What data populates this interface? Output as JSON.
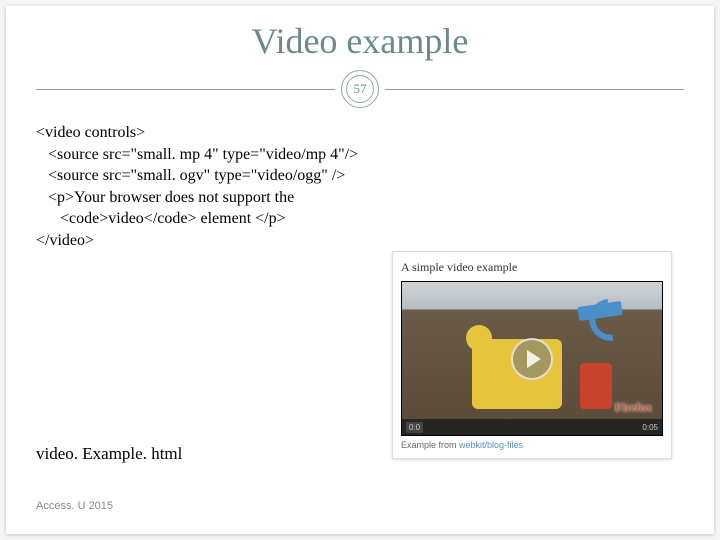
{
  "slide": {
    "title": "Video example",
    "number": "57",
    "code_lines": [
      "<video controls>",
      "   <source src=\"small. mp 4\" type=\"video/mp 4\"/>",
      "   <source src=\"small. ogv\" type=\"video/ogg\" />",
      "   <p>Your browser does not support the",
      "      <code>video</code> element </p>",
      "</video>"
    ],
    "filename": "video. Example. html",
    "conference": "Access. U 2015"
  },
  "video_card": {
    "heading": "A simple video example",
    "time_start": "0:0",
    "time_end": "0:05",
    "watermark": "Firefox",
    "footer_prefix": "Example from ",
    "footer_link": "webkit/blog-files"
  }
}
